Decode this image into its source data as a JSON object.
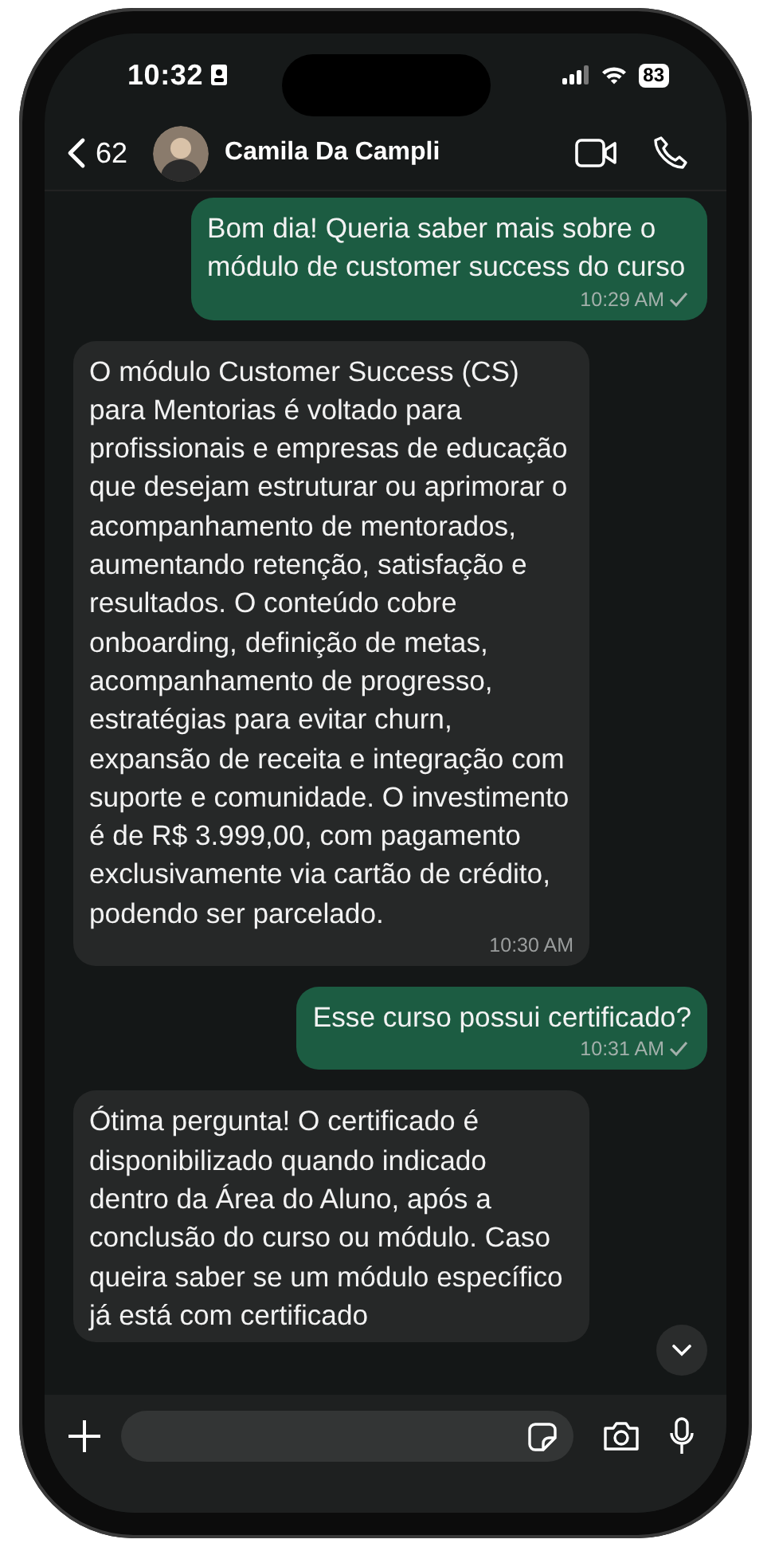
{
  "status_bar": {
    "time": "10:32",
    "battery": "83"
  },
  "header": {
    "back_count": "62",
    "contact_name": "Camila Da Campli"
  },
  "messages": [
    {
      "kind": "sent",
      "text": "Bom dia! Queria saber mais sobre o módulo de customer success do curso",
      "time": "10:29 AM",
      "delivered": false
    },
    {
      "kind": "received",
      "text": "O módulo Customer Success (CS) para Mentorias é voltado para profissionais e empresas de educação que desejam estruturar ou aprimorar o acompanhamento de mentorados, aumentando retenção, satisfação e resultados. O conteúdo cobre onboarding, definição de metas, acompanhamento de progresso, estratégias para evitar churn, expansão de receita e integração com suporte e comunidade. O investimento é de R$ 3.999,00, com pagamento exclusivamente via cartão de crédito, podendo ser parcelado.",
      "time": "10:30 AM"
    },
    {
      "kind": "sent",
      "text": "Esse curso possui certificado?",
      "time": "10:31 AM",
      "delivered": false
    },
    {
      "kind": "received",
      "text": "Ótima pergunta! O certificado é disponibilizado quando indicado dentro da Área do Aluno, após a conclusão do curso ou módulo. Caso queira saber se um módulo específico já está com certificado"
    }
  ]
}
